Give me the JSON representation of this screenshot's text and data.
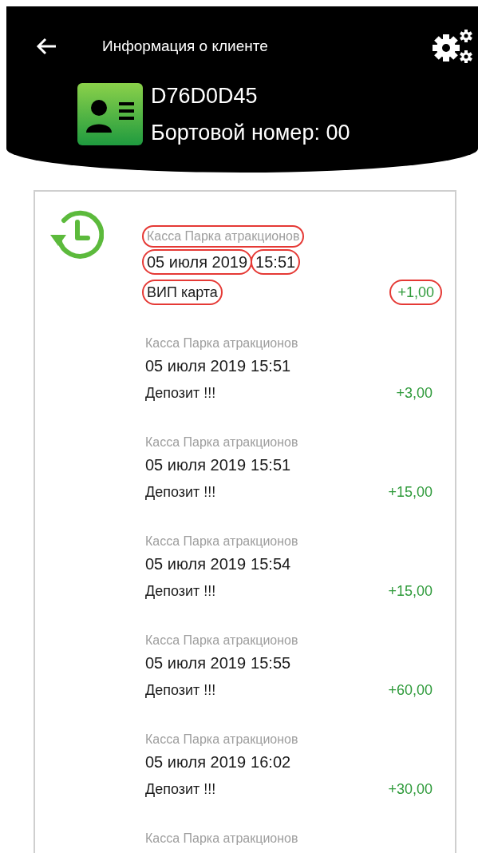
{
  "header": {
    "title": "Информация о клиенте",
    "card_id": "D76D0D45",
    "board_number": "Бортовой номер: 00"
  },
  "transactions": [
    {
      "source": "Касса Парка атракционов",
      "date": "05 июля 2019",
      "time": "15:51",
      "label": "ВИП карта",
      "amount": "+1,00",
      "highlighted": true
    },
    {
      "source": "Касса Парка атракционов",
      "date": "05 июля 2019",
      "time": "15:51",
      "label": "Депозит !!!",
      "amount": "+3,00",
      "highlighted": false
    },
    {
      "source": "Касса Парка атракционов",
      "date": "05 июля 2019",
      "time": "15:51",
      "label": "Депозит !!!",
      "amount": "+15,00",
      "highlighted": false
    },
    {
      "source": "Касса Парка атракционов",
      "date": "05 июля 2019",
      "time": "15:54",
      "label": "Депозит !!!",
      "amount": "+15,00",
      "highlighted": false
    },
    {
      "source": "Касса Парка атракционов",
      "date": "05 июля 2019",
      "time": "15:55",
      "label": "Депозит !!!",
      "amount": "+60,00",
      "highlighted": false
    },
    {
      "source": "Касса Парка атракционов",
      "date": "05 июля 2019",
      "time": "16:02",
      "label": "Депозит !!!",
      "amount": "+30,00",
      "highlighted": false
    },
    {
      "source": "Касса Парка атракционов",
      "highlighted": false
    }
  ]
}
